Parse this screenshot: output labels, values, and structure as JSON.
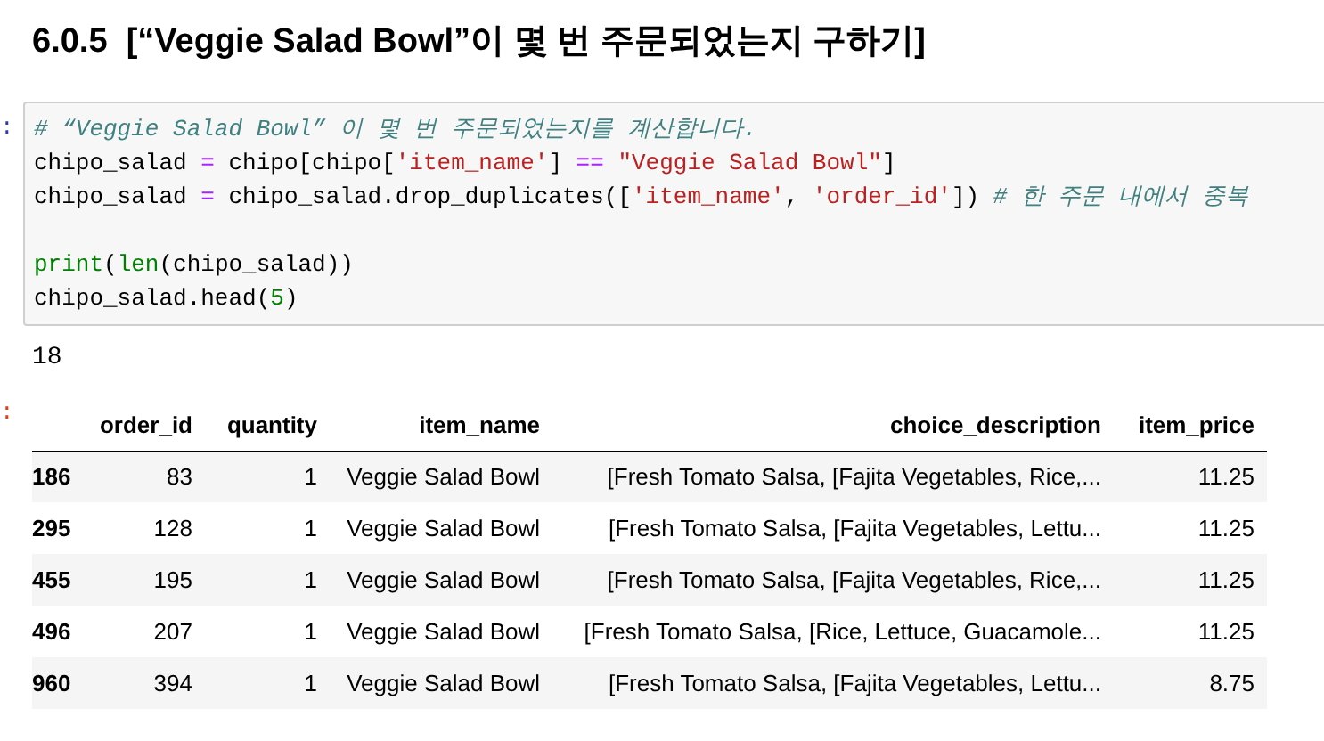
{
  "heading": "6.0.5  [“Veggie Salad Bowl”이 몇 번 주문되었는지 구하기]",
  "input_prompt": ":",
  "code_lines": [
    {
      "kind": "code",
      "tokens": [
        {
          "kind": "comment",
          "text": "# “Veggie Salad Bowl” 이 몇 번 주문되었는지를 계산합니다."
        }
      ]
    },
    {
      "kind": "code",
      "tokens": [
        {
          "kind": "plain",
          "text": "chipo_salad "
        },
        {
          "kind": "op",
          "text": "="
        },
        {
          "kind": "plain",
          "text": " chipo[chipo["
        },
        {
          "kind": "string",
          "text": "'item_name'"
        },
        {
          "kind": "plain",
          "text": "] "
        },
        {
          "kind": "op",
          "text": "=="
        },
        {
          "kind": "string",
          "text": " \"Veggie Salad Bowl\""
        },
        {
          "kind": "plain",
          "text": "]"
        }
      ]
    },
    {
      "kind": "code",
      "tokens": [
        {
          "kind": "plain",
          "text": "chipo_salad "
        },
        {
          "kind": "op",
          "text": "="
        },
        {
          "kind": "plain",
          "text": " chipo_salad.drop_duplicates(["
        },
        {
          "kind": "string",
          "text": "'item_name'"
        },
        {
          "kind": "plain",
          "text": ", "
        },
        {
          "kind": "string",
          "text": "'order_id'"
        },
        {
          "kind": "plain",
          "text": "]) "
        },
        {
          "kind": "comment",
          "text": "# 한 주문 내에서 중복"
        }
      ]
    },
    {
      "kind": "blank"
    },
    {
      "kind": "code",
      "tokens": [
        {
          "kind": "builtin",
          "text": "print"
        },
        {
          "kind": "plain",
          "text": "("
        },
        {
          "kind": "builtin",
          "text": "len"
        },
        {
          "kind": "plain",
          "text": "(chipo_salad))"
        }
      ]
    },
    {
      "kind": "code",
      "tokens": [
        {
          "kind": "plain",
          "text": "chipo_salad.head("
        },
        {
          "kind": "number",
          "text": "5"
        },
        {
          "kind": "plain",
          "text": ")"
        }
      ]
    }
  ],
  "print_output": "18",
  "output_prompt": ":",
  "table": {
    "columns": [
      "",
      "order_id",
      "quantity",
      "item_name",
      "choice_description",
      "item_price"
    ],
    "rows": [
      [
        "186",
        "83",
        "1",
        "Veggie Salad Bowl",
        "[Fresh Tomato Salsa, [Fajita Vegetables, Rice,...",
        "11.25"
      ],
      [
        "295",
        "128",
        "1",
        "Veggie Salad Bowl",
        "[Fresh Tomato Salsa, [Fajita Vegetables, Lettu...",
        "11.25"
      ],
      [
        "455",
        "195",
        "1",
        "Veggie Salad Bowl",
        "[Fresh Tomato Salsa, [Fajita Vegetables, Rice,...",
        "11.25"
      ],
      [
        "496",
        "207",
        "1",
        "Veggie Salad Bowl",
        "[Fresh Tomato Salsa, [Rice, Lettuce, Guacamole...",
        "11.25"
      ],
      [
        "960",
        "394",
        "1",
        "Veggie Salad Bowl",
        "[Fresh Tomato Salsa, [Fajita Vegetables, Lettu...",
        "8.75"
      ]
    ]
  }
}
